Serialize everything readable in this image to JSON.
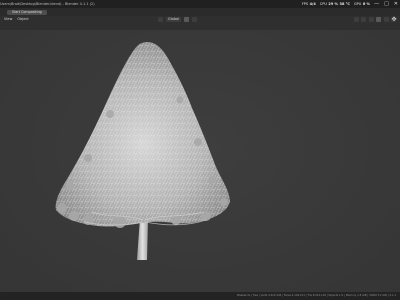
{
  "window": {
    "title": "Users\\Brad\\Desktop\\Blender.blend) - Blender 4.1.1 (2)"
  },
  "stats": {
    "fps_label": "FPS",
    "fps_value": "4/4",
    "cpu_label": "CPU",
    "cpu_value": "29 %",
    "cpu_temp": "38 °C",
    "gpu_label": "GPU",
    "gpu_value": "6 %"
  },
  "window_controls": {
    "minimize": "—",
    "maximize": "□",
    "close": "✕"
  },
  "toolbar": {
    "start_button": "Start Compositing"
  },
  "viewport_header": {
    "menu": [
      "View",
      "Object"
    ],
    "orientation": "Global",
    "icons": [
      "transform-pivot-icon",
      "snap-icon",
      "proportional-edit-icon"
    ]
  },
  "statusbar": {
    "text": "Weekends | Tree | Verts 4,322,444 | Faces 4,104,211 | Tris 8,412,118 | Objects 1/1 | Memory 1.8 GiB | VRAM 3.2 GiB | 4.1.1"
  },
  "colors": {
    "background": "#3a3a3a",
    "topbar": "#202020",
    "tree_foliage": "#bdbdbd",
    "trunk": "#d0d0d0"
  }
}
